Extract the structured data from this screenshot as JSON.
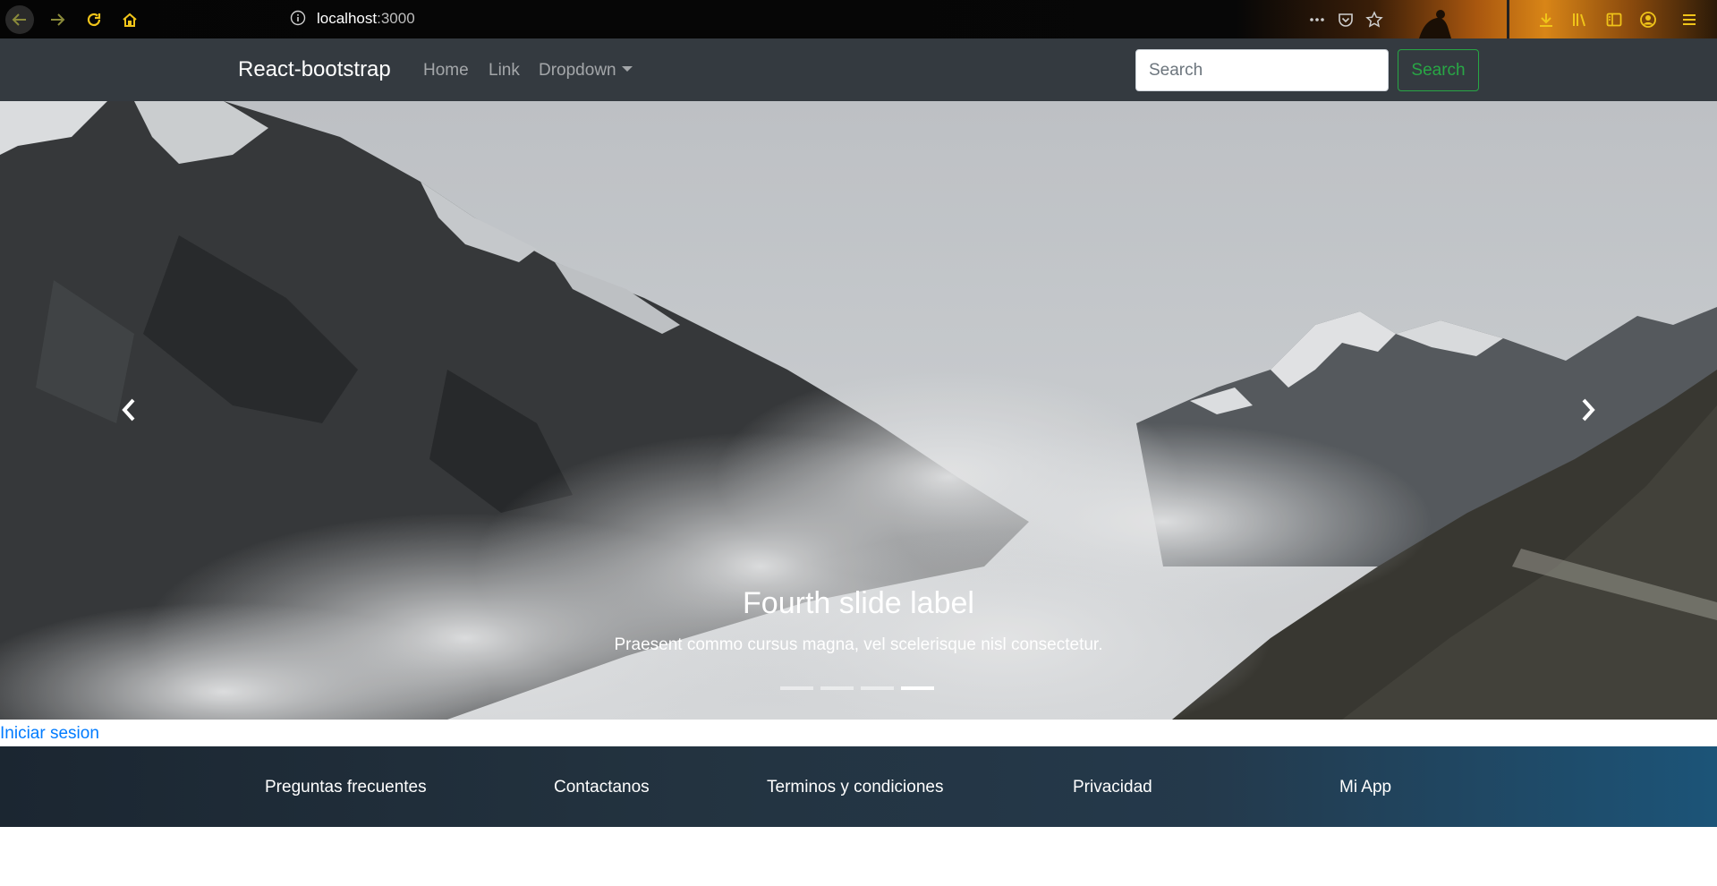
{
  "browser": {
    "url_host": "localhost",
    "url_port": ":3000",
    "icons": [
      "back-icon",
      "forward-icon",
      "reload-icon",
      "home-icon",
      "info-icon",
      "more-icon",
      "pocket-icon",
      "star-icon",
      "download-icon",
      "library-icon",
      "sidebar-icon",
      "account-icon",
      "menu-icon"
    ]
  },
  "navbar": {
    "brand": "React-bootstrap",
    "links": [
      "Home",
      "Link",
      "Dropdown"
    ],
    "search_placeholder": "Search",
    "search_button": "Search"
  },
  "carousel": {
    "caption_title": "Fourth slide label",
    "caption_text": "Praesent commo cursus magna, vel scelerisque nisl consectetur.",
    "indicator_count": 4,
    "active_indicator": 4
  },
  "login_link": "Iniciar sesion",
  "footer": {
    "links": [
      "Preguntas frecuentes",
      "Contactanos",
      "Terminos y condiciones",
      "Privacidad",
      "Mi App"
    ]
  },
  "colors": {
    "navbar_bg": "#343a40",
    "success_green": "#28a745",
    "link_blue": "#007bff",
    "chrome_accent": "#f0c419"
  }
}
